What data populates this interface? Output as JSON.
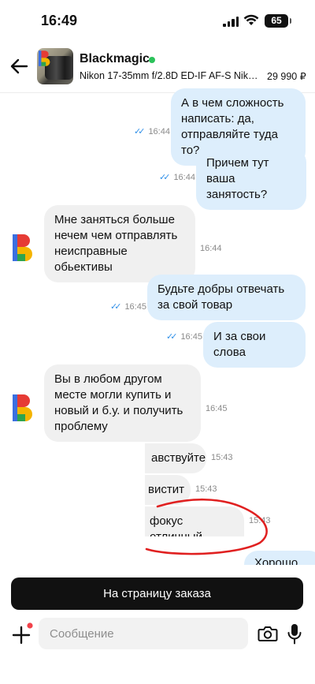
{
  "status_bar": {
    "time": "16:49",
    "battery": "65"
  },
  "header": {
    "seller_name": "Blackmagic",
    "product_title": "Nikon 17-35mm f/2.8D ED-IF AF-S Nikkor...",
    "price": "29 990 ₽"
  },
  "messages": [
    {
      "dir": "out",
      "text": "А в чем сложность написать: да, отправляйте туда то?",
      "time": "16:44",
      "read": true
    },
    {
      "dir": "out",
      "text": "Причем тут ваша занятость?",
      "time": "16:44",
      "read": true
    },
    {
      "dir": "in",
      "text": "Мне заняться больше нечем чем отправлять неисправные обьективы",
      "time": "16:44"
    },
    {
      "dir": "out",
      "text": "Будьте добры отвечать за свой товар",
      "time": "16:45",
      "read": true
    },
    {
      "dir": "out",
      "text": "И за свои слова",
      "time": "16:45",
      "read": true
    },
    {
      "dir": "in",
      "text": "Вы в любом другом месте могли купить и новый и б.у. и получить проблему",
      "time": "16:45"
    },
    {
      "dir": "in",
      "text": "авствуйте",
      "time": "15:43"
    },
    {
      "dir": "in",
      "text": "вистит",
      "time": "15:43"
    },
    {
      "dir": "in",
      "text": "фокус отличный",
      "time": "15:43"
    },
    {
      "dir": "out",
      "text": "Хорошо",
      "time": ""
    }
  ],
  "actions": {
    "order_button": "На страницу заказа"
  },
  "composer": {
    "placeholder": "Сообщение"
  },
  "colors": {
    "outgoing_bubble": "#ddeefc",
    "incoming_bubble": "#f0f0f0",
    "read_ticks": "#2f8fe8",
    "online": "#2bc25a",
    "annotation": "#e02020"
  }
}
